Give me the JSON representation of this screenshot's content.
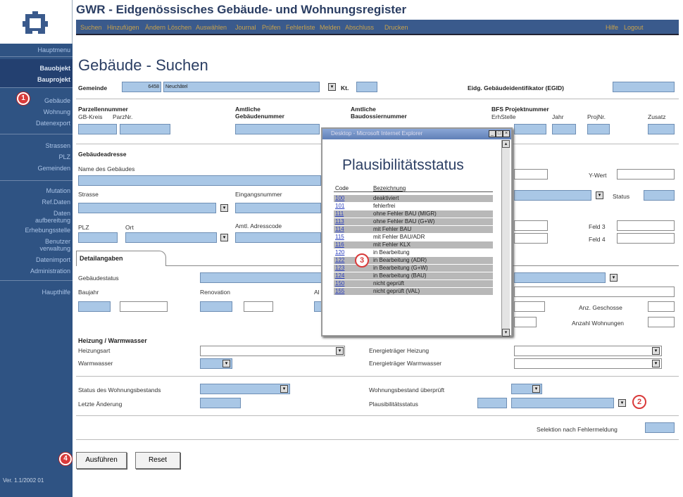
{
  "app": {
    "title": "GWR - Eidgenössisches Gebäude- und Wohnungsregister"
  },
  "menu": {
    "items": [
      "Suchen",
      "Hinzufügen",
      "Ändern",
      "Löschen",
      "Auswählen",
      "Journal",
      "Prüfen",
      "Fehlerliste",
      "Melden",
      "Abschluss",
      "Drucken"
    ],
    "help": "Hilfe",
    "logout": "Logout"
  },
  "sidebar": {
    "items": [
      "Hauptmenu",
      "Bauobjekt",
      "Bauprojekt",
      "Gebäude",
      "Wohnung",
      "Datenexport",
      "Strassen",
      "PLZ",
      "Gemeinden",
      "Mutation",
      "Ref.Daten",
      "Daten aufbereitung",
      "Erhebungsstelle",
      "Benutzer verwaltung",
      "Datenimport",
      "Administration",
      "Haupthilfe"
    ],
    "version": "Ver. 1.1/2002 01"
  },
  "page": {
    "title": "Gebäude - Suchen"
  },
  "form": {
    "gemeinde_label": "Gemeinde",
    "gemeinde_nr": "6458",
    "gemeinde_name": "Neuchâtel",
    "kt_label": "Kt.",
    "egid_label": "Eidg. Gebäudeidentifikator (EGID)",
    "parzelle_label": "Parzellennummer",
    "gbkreis_label": "GB-Kreis",
    "parznr_label": "ParzNr.",
    "amtl_geb_label": "Amtliche Gebäudenummer",
    "amtl_dossier_label": "Amtliche Baudossiernummer",
    "bfs_label": "BFS Projektnummer",
    "erhstelle_label": "ErhStelle",
    "jahr_label": "Jahr",
    "projnr_label": "ProjNr.",
    "zusatz_label": "Zusatz",
    "adresse_label": "Gebäudeadresse",
    "name_label": "Name des Gebäudes",
    "ywert_label": "Y-Wert",
    "strasse_label": "Strasse",
    "eingang_label": "Eingangsnummer",
    "status_label": "Status",
    "plz_label": "PLZ",
    "ort_label": "Ort",
    "adresscode_label": "Amtl. Adresscode",
    "feld3_label": "Feld 3",
    "feld4_label": "Feld 4",
    "tab_label": "Detailangaben",
    "gebstatus_label": "Gebäudestatus",
    "baujahr_label": "Baujahr",
    "renovation_label": "Renovation",
    "al_label": "Al",
    "geschosse_label": "Anz. Geschosse",
    "wohnungen_label": "Anzahl Wohnungen",
    "heizung_title": "Heizung / Warmwasser",
    "heizungsart_label": "Heizungsart",
    "warmwasser_label": "Warmwasser",
    "energie_heizung_label": "Energieträger Heizung",
    "energie_ww_label": "Energieträger Warmwasser",
    "wbestand_label": "Status des Wohnungsbestands",
    "letzte_label": "Letzte Änderung",
    "wbestand_ueber_label": "Wohnungsbestand überprüft",
    "plaus_label": "Plausibilitätsstatus",
    "selektion_label": "Selektion nach Fehlermeldung",
    "ausfuehren": "Ausführen",
    "reset": "Reset"
  },
  "popup": {
    "window_title": "Desktop - Microsoft Internet Explorer",
    "heading": "Plausibilitätsstatus",
    "col_code": "Code",
    "col_desc": "Bezeichnung",
    "rows": [
      {
        "code": "100",
        "desc": "deaktiviert"
      },
      {
        "code": "101",
        "desc": "fehlerfrei"
      },
      {
        "code": "111",
        "desc": "ohne Fehler BAU (MIGR)"
      },
      {
        "code": "113",
        "desc": "ohne Fehler BAU (G+W)"
      },
      {
        "code": "114",
        "desc": "mit Fehler BAU"
      },
      {
        "code": "115",
        "desc": "mit Fehler BAU/ADR"
      },
      {
        "code": "116",
        "desc": "mit Fehler KLX"
      },
      {
        "code": "120",
        "desc": "in Bearbeitung"
      },
      {
        "code": "122",
        "desc": "in Bearbeitung (ADR)"
      },
      {
        "code": "123",
        "desc": "in Bearbeitung (G+W)"
      },
      {
        "code": "124",
        "desc": "in Bearbeitung (BAU)"
      },
      {
        "code": "150",
        "desc": "nicht geprüft"
      },
      {
        "code": "155",
        "desc": "nicht geprüft (VAL)"
      }
    ]
  },
  "markers": [
    "1",
    "2",
    "3",
    "4"
  ],
  "colors": {
    "sidebar": "#2f5383",
    "title": "#2b3e63",
    "input": "#a9c7e6",
    "marker": "#d93a3a"
  }
}
